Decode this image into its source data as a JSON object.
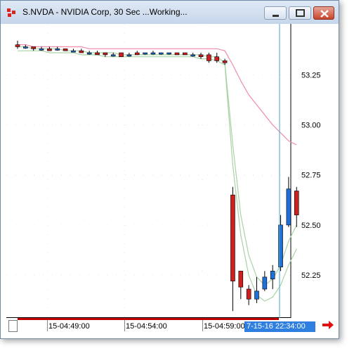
{
  "window": {
    "title": "S.NVDA - NVIDIA Corp, 30 Sec ...Working...",
    "buttons": [
      "minimize",
      "maximize",
      "close"
    ]
  },
  "colors": {
    "up_candle": "#1f6fd6",
    "down_candle": "#cc1f1f",
    "pink_line": "#f08aa8",
    "green_line": "#a9d3a6",
    "cursor_line": "#4aa3c9",
    "cursor_label": "#2e7fe0"
  },
  "time_axis": {
    "labels": [
      "15-04:49:00",
      "15-04:54:00",
      "15-04:59:00"
    ],
    "cursor_label": "7-15-16 22:34:00"
  },
  "chart_data": {
    "type": "candlestick",
    "y_axis": {
      "ticks": [
        53.25,
        53.0,
        52.75,
        52.5,
        52.25
      ],
      "ylim": [
        52.05,
        53.49
      ]
    },
    "bars": [
      {
        "o": 53.4,
        "h": 53.42,
        "l": 53.38,
        "c": 53.39
      },
      {
        "o": 53.39,
        "h": 53.4,
        "l": 53.38,
        "c": 53.39
      },
      {
        "o": 53.39,
        "h": 53.39,
        "l": 53.37,
        "c": 53.38
      },
      {
        "o": 53.38,
        "h": 53.39,
        "l": 53.37,
        "c": 53.38
      },
      {
        "o": 53.38,
        "h": 53.39,
        "l": 53.37,
        "c": 53.37
      },
      {
        "o": 53.38,
        "h": 53.39,
        "l": 53.37,
        "c": 53.38
      },
      {
        "o": 53.38,
        "h": 53.38,
        "l": 53.37,
        "c": 53.37
      },
      {
        "o": 53.37,
        "h": 53.38,
        "l": 53.37,
        "c": 53.37
      },
      {
        "o": 53.37,
        "h": 53.38,
        "l": 53.36,
        "c": 53.36
      },
      {
        "o": 53.36,
        "h": 53.37,
        "l": 53.35,
        "c": 53.36
      },
      {
        "o": 53.36,
        "h": 53.37,
        "l": 53.35,
        "c": 53.35
      },
      {
        "o": 53.36,
        "h": 53.36,
        "l": 53.34,
        "c": 53.35
      },
      {
        "o": 53.35,
        "h": 53.36,
        "l": 53.34,
        "c": 53.35
      },
      {
        "o": 53.36,
        "h": 53.36,
        "l": 53.34,
        "c": 53.34
      },
      {
        "o": 53.35,
        "h": 53.36,
        "l": 53.34,
        "c": 53.35
      },
      {
        "o": 53.36,
        "h": 53.37,
        "l": 53.35,
        "c": 53.35
      },
      {
        "o": 53.36,
        "h": 53.36,
        "l": 53.35,
        "c": 53.36
      },
      {
        "o": 53.36,
        "h": 53.37,
        "l": 53.35,
        "c": 53.36
      },
      {
        "o": 53.36,
        "h": 53.36,
        "l": 53.35,
        "c": 53.36
      },
      {
        "o": 53.36,
        "h": 53.36,
        "l": 53.35,
        "c": 53.36
      },
      {
        "o": 53.36,
        "h": 53.36,
        "l": 53.35,
        "c": 53.35
      },
      {
        "o": 53.36,
        "h": 53.36,
        "l": 53.35,
        "c": 53.35
      },
      {
        "o": 53.35,
        "h": 53.36,
        "l": 53.34,
        "c": 53.35
      },
      {
        "o": 53.35,
        "h": 53.36,
        "l": 53.33,
        "c": 53.34
      },
      {
        "o": 53.35,
        "h": 53.36,
        "l": 53.31,
        "c": 53.32
      },
      {
        "o": 53.34,
        "h": 53.36,
        "l": 53.31,
        "c": 53.32
      },
      {
        "o": 53.32,
        "h": 53.33,
        "l": 53.3,
        "c": 53.31
      },
      {
        "o": 52.65,
        "h": 52.69,
        "l": 52.07,
        "c": 52.22
      },
      {
        "o": 52.27,
        "h": 52.27,
        "l": 52.13,
        "c": 52.19
      },
      {
        "o": 52.18,
        "h": 52.2,
        "l": 52.1,
        "c": 52.13
      },
      {
        "o": 52.13,
        "h": 52.24,
        "l": 52.11,
        "c": 52.17
      },
      {
        "o": 52.18,
        "h": 52.27,
        "l": 52.17,
        "c": 52.24
      },
      {
        "o": 52.23,
        "h": 52.3,
        "l": 52.18,
        "c": 52.27
      },
      {
        "o": 52.29,
        "h": 52.55,
        "l": 52.27,
        "c": 52.5
      },
      {
        "o": 52.5,
        "h": 52.74,
        "l": 52.49,
        "c": 52.68
      },
      {
        "o": 52.67,
        "h": 52.69,
        "l": 52.49,
        "c": 52.55
      }
    ],
    "series": [
      {
        "values": [
          53.4,
          53.4,
          53.39,
          53.39,
          53.39,
          53.39,
          53.39,
          53.39,
          53.39,
          53.38,
          53.38,
          53.38,
          53.38,
          53.38,
          53.38,
          53.38,
          53.38,
          53.38,
          53.38,
          53.38,
          53.38,
          53.38,
          53.38,
          53.38,
          53.38,
          53.38,
          53.37,
          53.3,
          53.22,
          53.15,
          53.1,
          53.05,
          53.0,
          52.96,
          52.92,
          52.9
        ]
      },
      {
        "values": [
          53.39,
          53.39,
          53.38,
          53.38,
          53.38,
          53.38,
          53.37,
          53.37,
          53.37,
          53.36,
          53.36,
          53.36,
          53.36,
          53.35,
          53.35,
          53.35,
          53.35,
          53.35,
          53.35,
          53.35,
          53.35,
          53.35,
          53.35,
          53.35,
          53.34,
          53.34,
          53.31,
          52.9,
          52.55,
          52.35,
          52.24,
          52.2,
          52.23,
          52.3,
          52.42,
          52.5
        ]
      },
      {
        "values": [
          53.37,
          53.37,
          53.37,
          53.37,
          53.36,
          53.36,
          53.36,
          53.36,
          53.35,
          53.35,
          53.35,
          53.34,
          53.34,
          53.34,
          53.34,
          53.34,
          53.34,
          53.34,
          53.34,
          53.34,
          53.34,
          53.34,
          53.34,
          53.33,
          53.33,
          53.32,
          53.3,
          52.8,
          52.45,
          52.25,
          52.15,
          52.12,
          52.14,
          52.2,
          52.3,
          52.38
        ]
      }
    ]
  }
}
